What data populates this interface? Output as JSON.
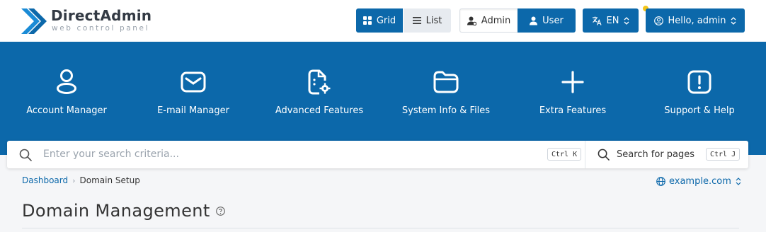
{
  "brand": {
    "name": "DirectAdmin",
    "tagline": "web control panel",
    "accent": "#0c68aa"
  },
  "header": {
    "view_grid": "Grid",
    "view_list": "List",
    "level_admin": "Admin",
    "level_user": "User",
    "language": "EN",
    "greeting": "Hello, admin",
    "active_view": "Grid",
    "active_level": "User"
  },
  "nav": {
    "items": [
      {
        "label": "Account Manager",
        "icon": "user-icon"
      },
      {
        "label": "E-mail Manager",
        "icon": "envelope-icon"
      },
      {
        "label": "Advanced Features",
        "icon": "document-gear-icon"
      },
      {
        "label": "System Info & Files",
        "icon": "folder-icon"
      },
      {
        "label": "Extra Features",
        "icon": "plus-icon"
      },
      {
        "label": "Support & Help",
        "icon": "exclamation-icon"
      }
    ]
  },
  "search": {
    "placeholder": "Enter your search criteria...",
    "shortcut": "Ctrl K",
    "pages_label": "Search for pages",
    "pages_shortcut": "Ctrl J"
  },
  "breadcrumb": {
    "items": [
      "Dashboard",
      "Domain Setup"
    ]
  },
  "domain": {
    "selected": "example.com"
  },
  "page": {
    "title": "Domain Management"
  }
}
